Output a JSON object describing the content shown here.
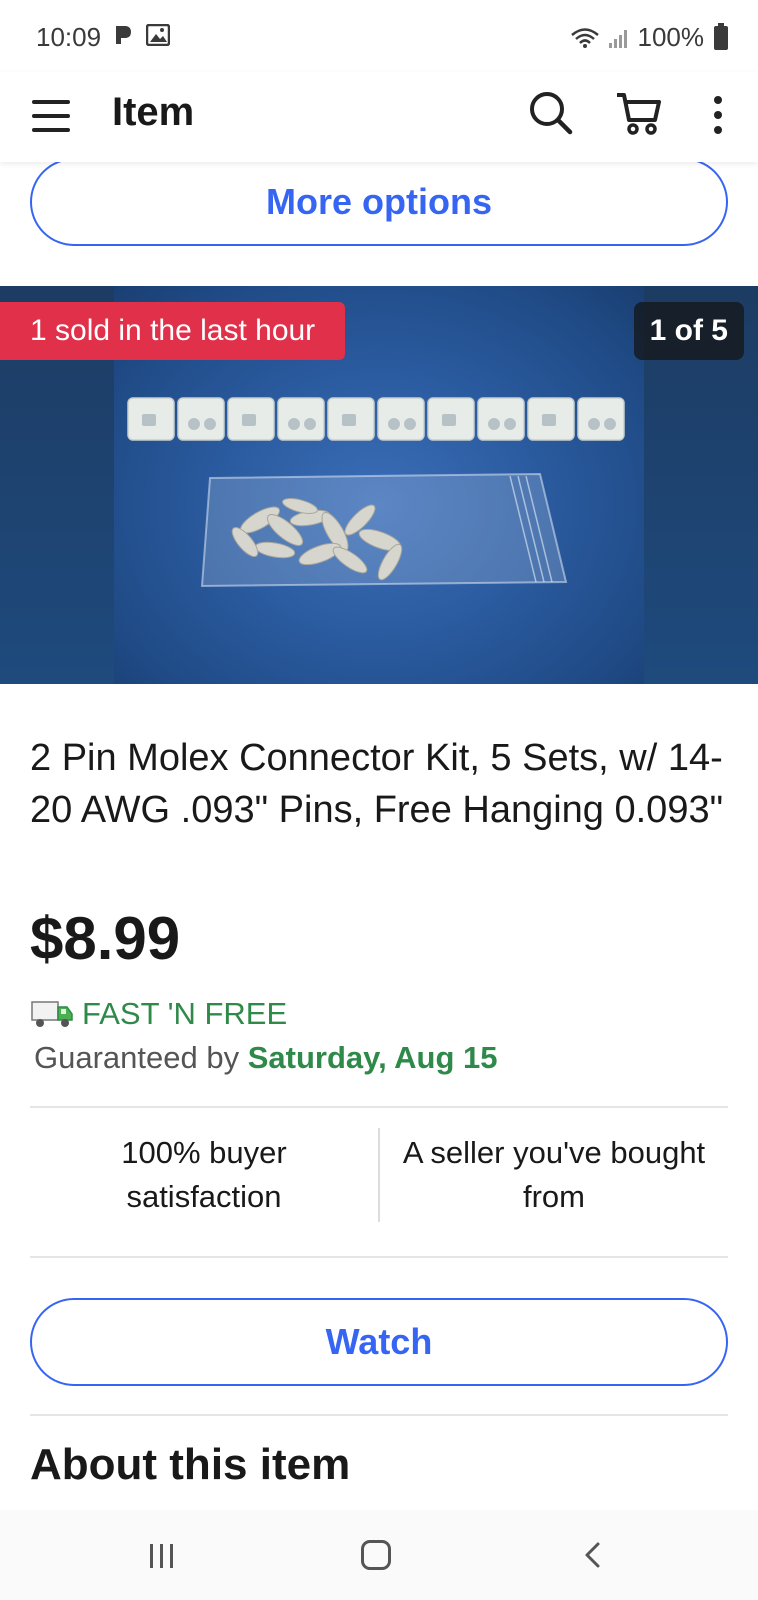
{
  "status_bar": {
    "time": "10:09",
    "battery": "100%",
    "left_icons": [
      "pay-icon",
      "image-icon"
    ],
    "right_icons": [
      "wifi-icon",
      "signal-icon",
      "battery-icon"
    ]
  },
  "app_bar": {
    "title": "Item",
    "icons": [
      "menu-icon",
      "search-icon",
      "cart-icon",
      "more-vertical-icon"
    ]
  },
  "more_options_label": "More options",
  "hero": {
    "sold_badge": "1 sold in the last hour",
    "image_counter": "1 of 5"
  },
  "item": {
    "title": "2 Pin Molex Connector Kit, 5 Sets, w/ 14-20 AWG .093\" Pins, Free Hanging 0.093\"",
    "price": "$8.99",
    "shipping_label": "FAST 'N FREE",
    "guarantee_prefix": "Guaranteed by",
    "guarantee_date": "Saturday, Aug 15"
  },
  "stats": [
    {
      "text": "100% buyer satisfaction"
    },
    {
      "text": "A seller you've bought from"
    }
  ],
  "watch_label": "Watch",
  "about_heading": "About this item",
  "colors": {
    "accent": "#3665f3",
    "sold_badge": "#e0304a",
    "shipping_green": "#2f8a4a"
  }
}
